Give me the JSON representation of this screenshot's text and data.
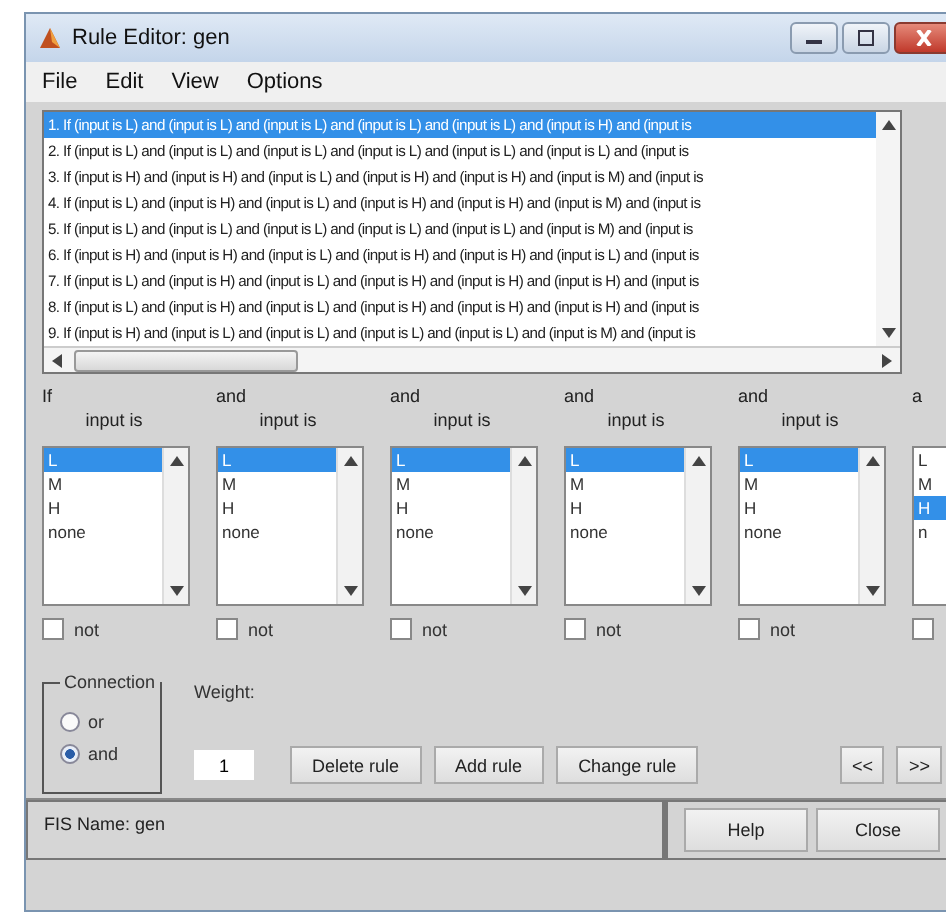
{
  "window": {
    "title": "Rule Editor: gen"
  },
  "menu": [
    "File",
    "Edit",
    "View",
    "Options"
  ],
  "rules": [
    {
      "text": "1. If (input is L) and (input is L) and (input is L) and (input is L) and (input is L) and (input is H) and (input is",
      "selected": true
    },
    {
      "text": "2. If (input is L) and (input is L) and (input is L) and (input is L) and (input is L) and (input is L) and (input is",
      "selected": false
    },
    {
      "text": "3. If (input is H) and (input is H) and (input is L) and (input is H) and (input is H) and (input is M) and (input is",
      "selected": false
    },
    {
      "text": "4. If (input is L) and (input is H) and (input is L) and (input is H) and (input is H) and (input is M) and (input is",
      "selected": false
    },
    {
      "text": "5. If (input is L) and (input is L) and (input is L) and (input is L) and (input is L) and (input is M) and (input is",
      "selected": false
    },
    {
      "text": "6. If (input is H) and (input is H) and (input is L) and (input is H) and (input is H) and (input is L) and (input is",
      "selected": false
    },
    {
      "text": "7. If (input is L) and (input is H) and (input is L) and (input is H) and (input is H) and (input is H) and (input is",
      "selected": false
    },
    {
      "text": "8. If (input is L) and (input is H) and (input is L) and (input is H) and (input is H) and (input is H) and (input is",
      "selected": false
    },
    {
      "text": "9. If (input is H) and (input is L) and (input is L) and (input is L) and (input is L) and (input is M) and (input is",
      "selected": false
    }
  ],
  "antecedents": [
    {
      "connector": "If",
      "label": "input is",
      "options": [
        {
          "text": "L",
          "selected": true
        },
        {
          "text": "M",
          "selected": false
        },
        {
          "text": "H",
          "selected": false
        },
        {
          "text": "none",
          "selected": false
        }
      ],
      "not": {
        "label": "not",
        "checked": false
      }
    },
    {
      "connector": "and",
      "label": "input is",
      "options": [
        {
          "text": "L",
          "selected": true
        },
        {
          "text": "M",
          "selected": false
        },
        {
          "text": "H",
          "selected": false
        },
        {
          "text": "none",
          "selected": false
        }
      ],
      "not": {
        "label": "not",
        "checked": false
      }
    },
    {
      "connector": "and",
      "label": "input is",
      "options": [
        {
          "text": "L",
          "selected": true
        },
        {
          "text": "M",
          "selected": false
        },
        {
          "text": "H",
          "selected": false
        },
        {
          "text": "none",
          "selected": false
        }
      ],
      "not": {
        "label": "not",
        "checked": false
      }
    },
    {
      "connector": "and",
      "label": "input is",
      "options": [
        {
          "text": "L",
          "selected": true
        },
        {
          "text": "M",
          "selected": false
        },
        {
          "text": "H",
          "selected": false
        },
        {
          "text": "none",
          "selected": false
        }
      ],
      "not": {
        "label": "not",
        "checked": false
      }
    },
    {
      "connector": "and",
      "label": "input is",
      "options": [
        {
          "text": "L",
          "selected": true
        },
        {
          "text": "M",
          "selected": false
        },
        {
          "text": "H",
          "selected": false
        },
        {
          "text": "none",
          "selected": false
        }
      ],
      "not": {
        "label": "not",
        "checked": false
      }
    },
    {
      "connector": "a",
      "options": [
        {
          "text": "L",
          "selected": false
        },
        {
          "text": "M",
          "selected": false
        },
        {
          "text": "H",
          "selected": true
        },
        {
          "text": "n",
          "selected": false
        }
      ],
      "not": {
        "checked": false
      }
    }
  ],
  "connection": {
    "title": "Connection",
    "options": [
      {
        "label": "or",
        "selected": false
      },
      {
        "label": "and",
        "selected": true
      }
    ]
  },
  "weight": {
    "label": "Weight:",
    "value": "1"
  },
  "buttons": [
    "Delete rule",
    "Add rule",
    "Change rule"
  ],
  "nav_buttons": [
    "<<",
    ">>"
  ],
  "status": "FIS Name: gen",
  "footer_buttons": [
    "Help",
    "Close"
  ]
}
